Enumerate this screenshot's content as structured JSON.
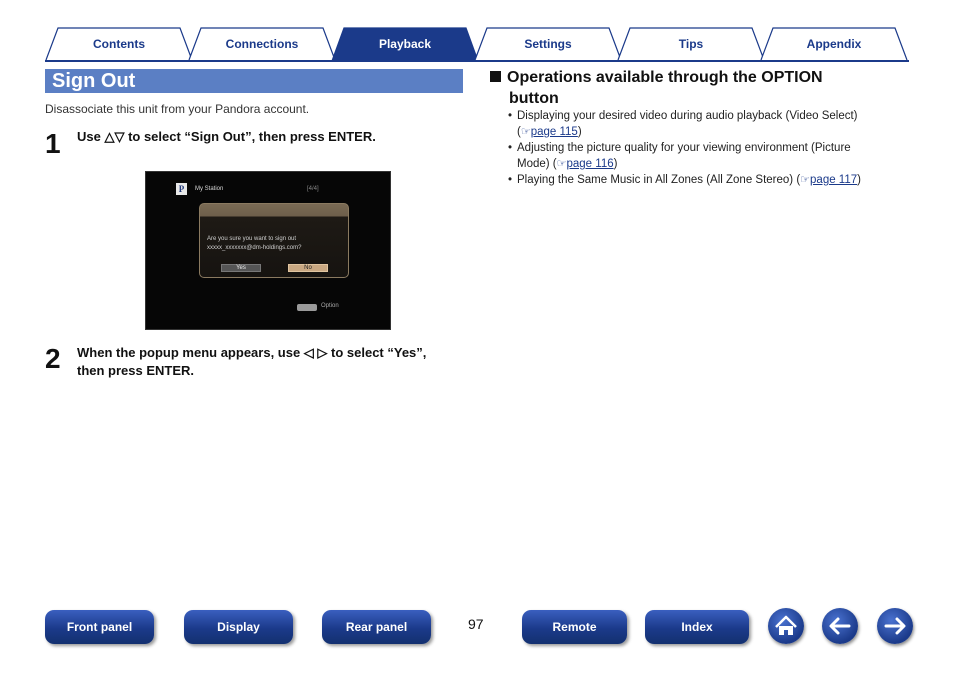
{
  "tabs": [
    {
      "label": "Contents",
      "active": false
    },
    {
      "label": "Connections",
      "active": false
    },
    {
      "label": "Playback",
      "active": true
    },
    {
      "label": "Settings",
      "active": false
    },
    {
      "label": "Tips",
      "active": false
    },
    {
      "label": "Appendix",
      "active": false
    }
  ],
  "section": {
    "title": "Sign Out",
    "description": "Disassociate this unit from your Pandora account."
  },
  "steps": [
    {
      "number": "1",
      "text": "Use △▽ to select “Sign Out”, then press ENTER."
    },
    {
      "number": "2",
      "line1": "When the popup menu appears, use ◁ ▷ to select “Yes”,",
      "line2": "then press ENTER."
    }
  ],
  "screen": {
    "logo": "P",
    "station": "My Station",
    "counter": "[4/4]",
    "popup_line1": "Are you sure you want to sign out",
    "popup_line2": "xxxxx_xxxxxxx@dm-holdings.com?",
    "yes": "Yes",
    "no": "No",
    "option_label": "Option"
  },
  "options": {
    "heading_line1": "Operations available through the OPTION",
    "heading_line2": "button",
    "items": [
      {
        "text_line1": "Displaying your desired video during audio playback (Video Select)",
        "prefix": "(",
        "link": "page 115",
        "suffix": ")"
      },
      {
        "text_line1": "Adjusting the picture quality for your viewing environment (Picture",
        "text_line2": "Mode) (",
        "link": "page 116",
        "suffix": ")"
      },
      {
        "text_line1": "Playing the Same Music in All Zones (All Zone Stereo) (",
        "link": "page 117",
        "suffix": ")"
      }
    ]
  },
  "footer": {
    "buttons": [
      "Front panel",
      "Display",
      "Rear panel",
      "Remote",
      "Index"
    ],
    "page_number": "97",
    "icons": [
      "home-icon",
      "back-arrow-icon",
      "forward-arrow-icon"
    ]
  },
  "colors": {
    "accent": "#1b3a8a",
    "section_bar": "#5b7fc4"
  }
}
